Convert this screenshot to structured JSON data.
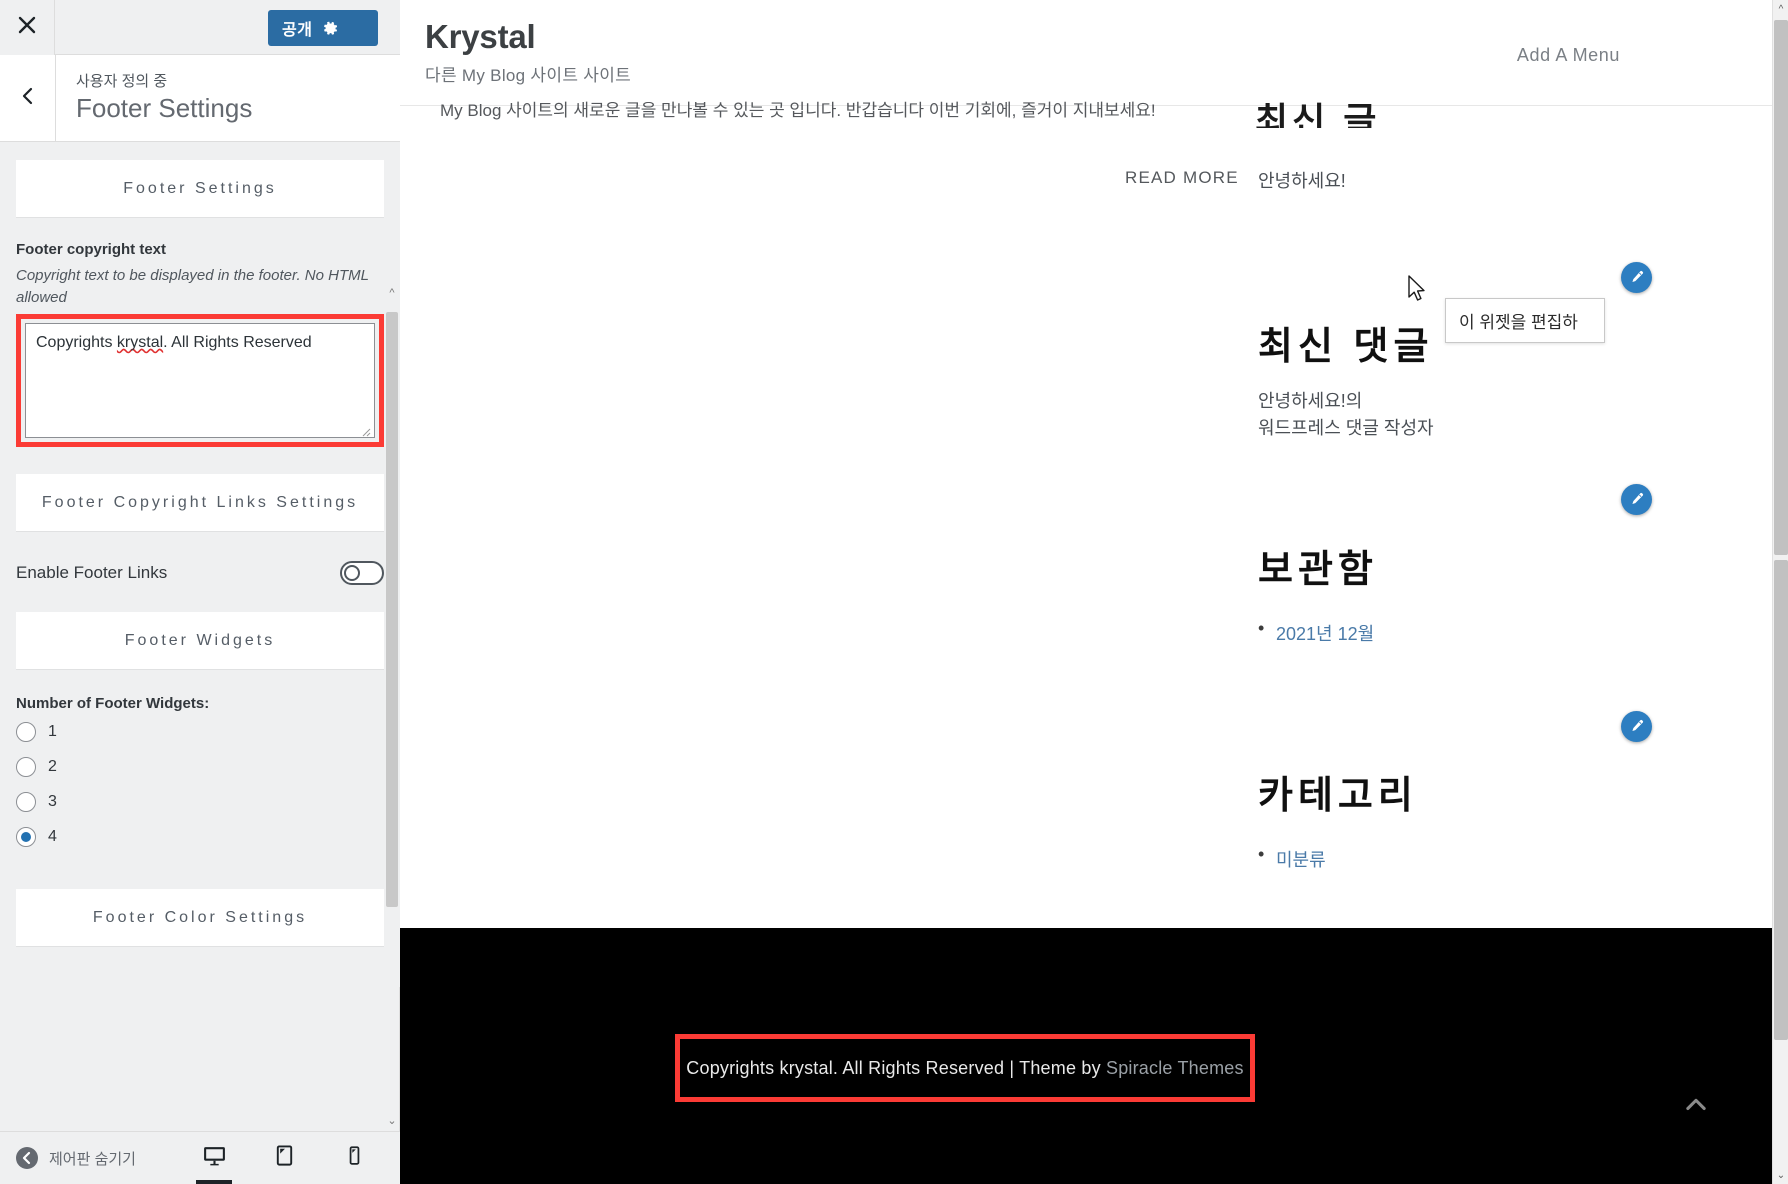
{
  "customizer": {
    "topbar": {
      "close_icon": "close-icon",
      "publish_label": "공개",
      "gear_icon": "gear-icon"
    },
    "header": {
      "back_icon": "chevron-left-icon",
      "eyebrow": "사용자 정의 중",
      "title": "Footer Settings"
    },
    "sections": {
      "footer_settings": "Footer Settings",
      "footer_copyright_links": "Footer Copyright Links Settings",
      "footer_widgets": "Footer Widgets",
      "footer_color": "Footer Color Settings"
    },
    "copyright_field": {
      "label": "Footer copyright text",
      "description": "Copyright text to be displayed in the footer. No HTML allowed",
      "value_part1": "Copyrights ",
      "value_misspelled": "krystal",
      "value_part2": ". All Rights Reserved",
      "full_value": "Copyrights krystal. All Rights Reserved"
    },
    "enable_footer_links": {
      "label": "Enable Footer Links",
      "state": "off"
    },
    "widgets_count": {
      "label": "Number of Footer Widgets:",
      "options": [
        "1",
        "2",
        "3",
        "4"
      ],
      "selected": "4"
    },
    "footbar": {
      "collapse_label": "제어판 숨기기",
      "collapse_icon": "chevron-left-circle-icon",
      "devices": [
        {
          "name": "desktop-icon",
          "active": true
        },
        {
          "name": "tablet-icon",
          "active": false
        },
        {
          "name": "mobile-icon",
          "active": false
        }
      ]
    }
  },
  "preview": {
    "site": {
      "title": "Krystal",
      "tagline": "다른 My Blog 사이트 사이트"
    },
    "nav": {
      "add_menu": "Add A Menu"
    },
    "post_excerpt_clipped": "My Blog 사이트의 새로운 글을 만나볼 수 있는 곳 입니다. 반갑습니다 이번 기회에, 즐거이 지내보세요!",
    "read_more": "READ MORE",
    "widgets": [
      {
        "heading": "최신 글",
        "clipped": true,
        "items": [
          "안녕하세요!"
        ],
        "edit_icon": "edit-pencil-icon"
      },
      {
        "heading": "최신 댓글",
        "clipped": false,
        "text_lines": [
          "안녕하세요!의",
          "워드프레스 댓글 작성자"
        ],
        "edit_icon": "edit-pencil-icon"
      },
      {
        "heading": "보관함",
        "clipped": false,
        "items": [
          "2021년 12월"
        ],
        "edit_icon": "edit-pencil-icon"
      },
      {
        "heading": "카테고리",
        "clipped": false,
        "items": [
          "미분류"
        ],
        "edit_icon": "edit-pencil-icon"
      }
    ],
    "tooltip": "이 위젯을 편집하",
    "cursor": "mouse-pointer",
    "footer": {
      "copyright_main": "Copyrights krystal. All Rights Reserved | Theme by ",
      "copyright_link": "Spiracle Themes",
      "back_to_top_icon": "chevron-up-icon"
    }
  },
  "colors": {
    "publish_blue": "#2b6ca3",
    "highlight_red": "#fb3b35",
    "radio_blue": "#2271b1",
    "edit_icon_blue": "#2d7ec1",
    "footer_black": "#000000",
    "sidebar_gray": "#eff0f1",
    "link_blue": "#4a7aa8"
  }
}
